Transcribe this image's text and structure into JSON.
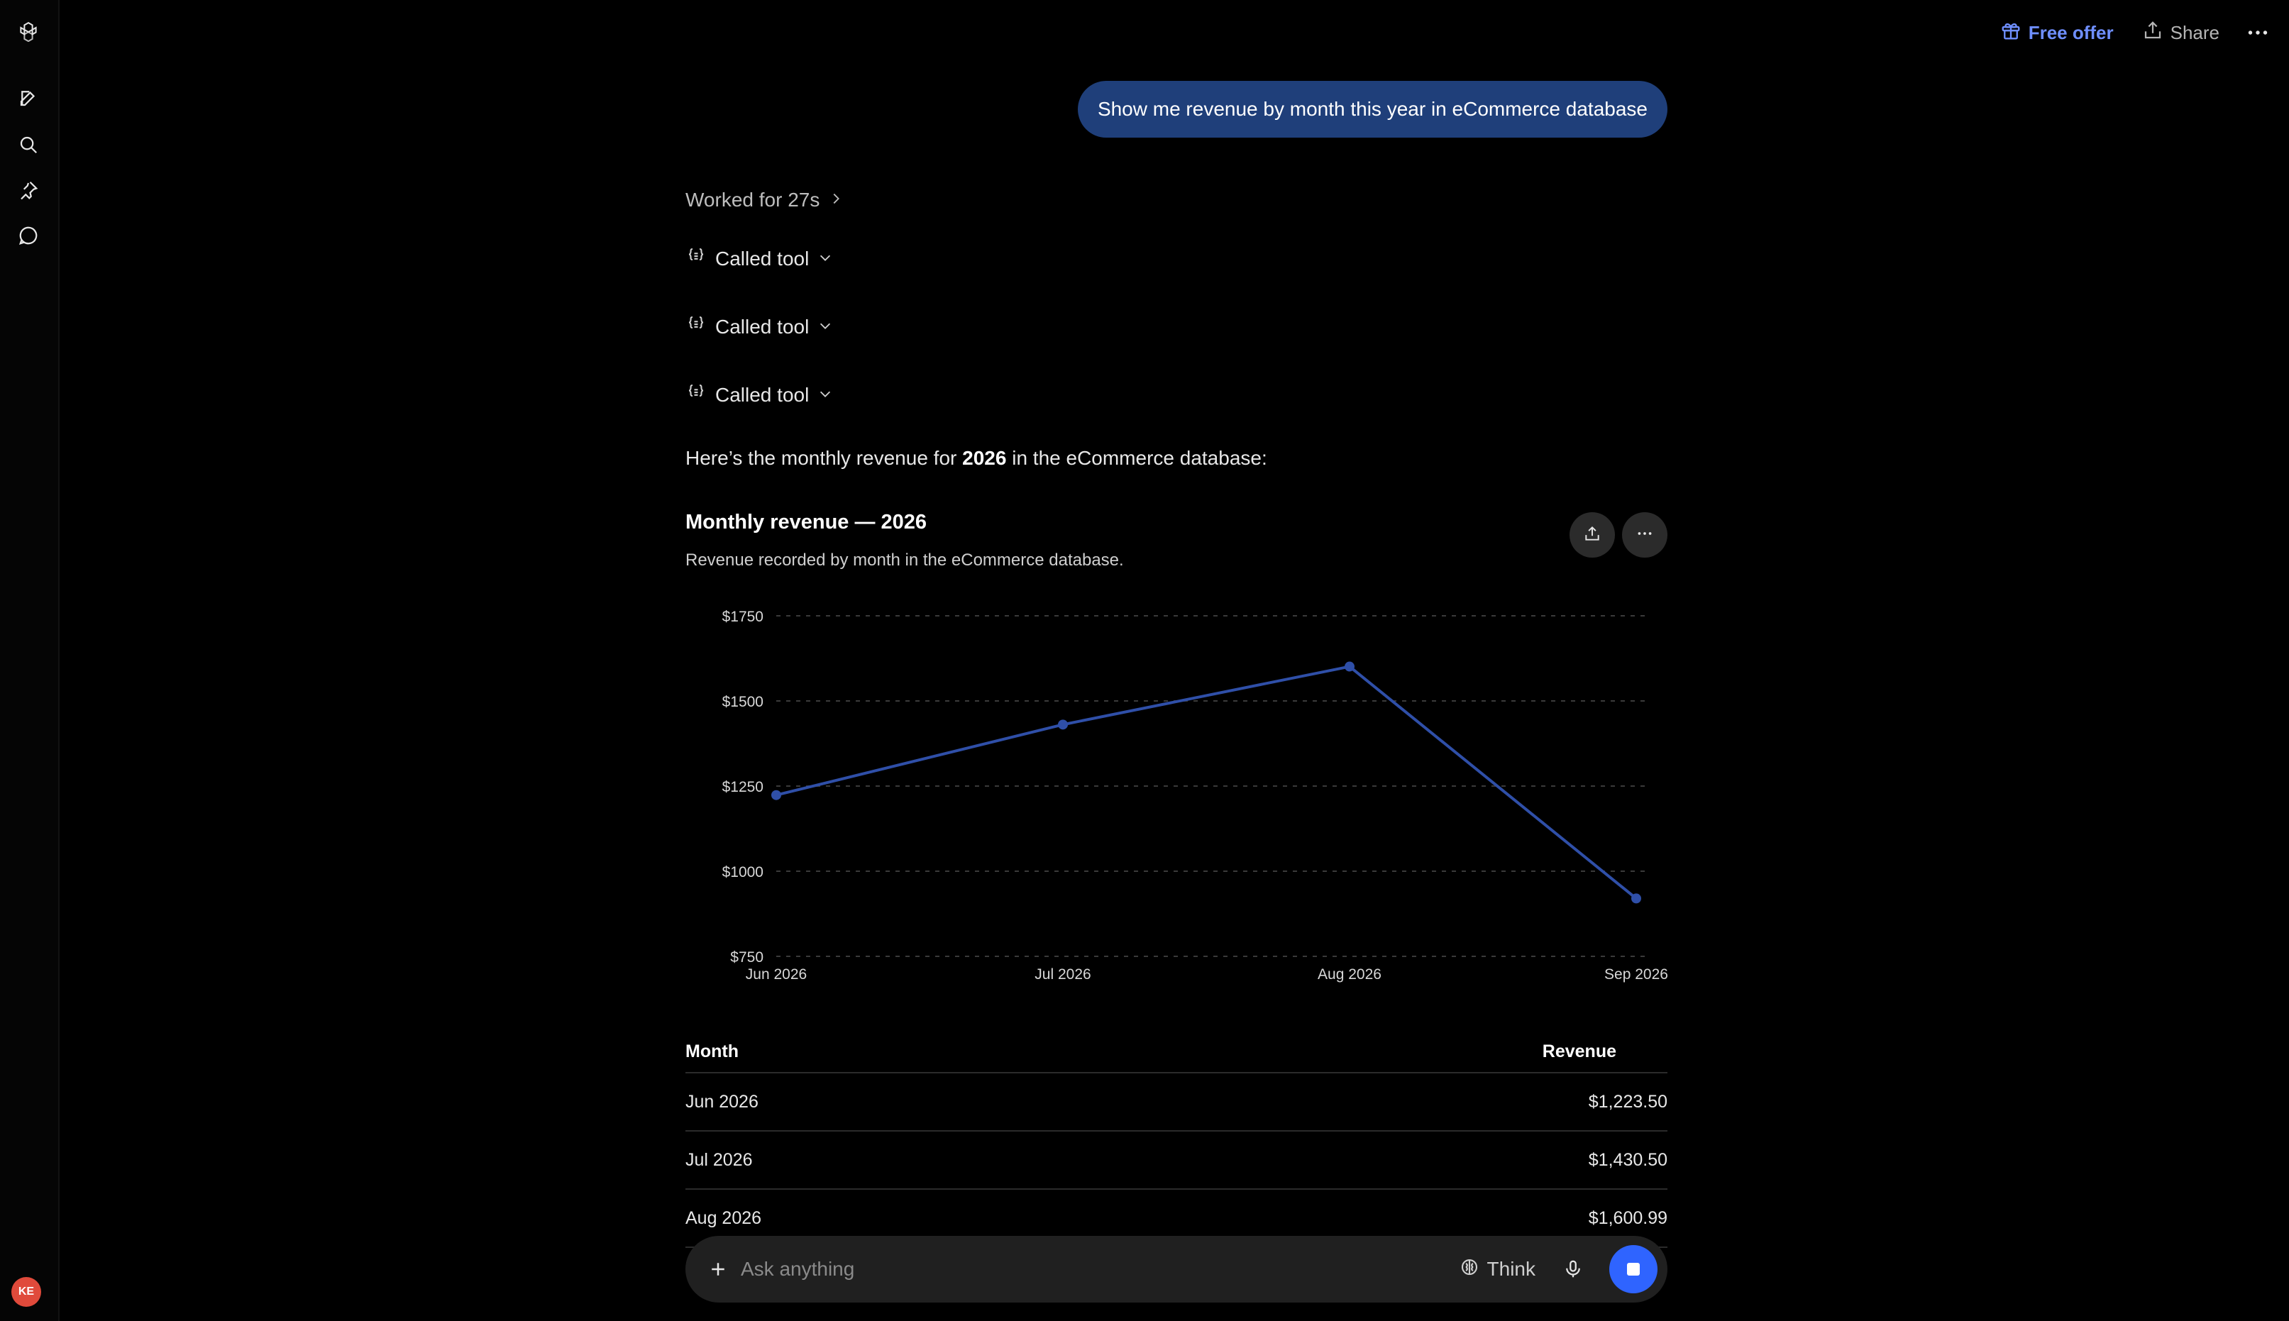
{
  "topbar": {
    "free_offer": "Free offer",
    "share": "Share"
  },
  "conversation": {
    "user_message": "Show me revenue by month this year in eCommerce database",
    "worked_for": "Worked for 27s",
    "tool_calls": [
      {
        "label": "Called tool"
      },
      {
        "label": "Called tool"
      },
      {
        "label": "Called tool"
      }
    ],
    "intro_prefix": "Here’s the monthly revenue for ",
    "intro_year": "2026",
    "intro_suffix": " in the eCommerce database:"
  },
  "chart_card": {
    "title": "Monthly revenue — 2026",
    "subtitle": "Revenue recorded by month in the eCommerce database."
  },
  "chart_data": {
    "type": "line",
    "categories": [
      "Jun 2026",
      "Jul 2026",
      "Aug 2026",
      "Sep 2026"
    ],
    "series": [
      {
        "values": [
          1223.5,
          1430.5,
          1600.99,
          920
        ]
      }
    ],
    "ylim": [
      750,
      1750
    ],
    "yticks": [
      750,
      1000,
      1250,
      1500,
      1750
    ],
    "ytick_labels": [
      "$750",
      "$1000",
      "$1250",
      "$1500",
      "$1750"
    ],
    "grid": true,
    "line_color": "#2f4fa8"
  },
  "table": {
    "headers": {
      "month": "Month",
      "revenue": "Revenue"
    },
    "rows": [
      {
        "month": "Jun 2026",
        "revenue": "$1,223.50"
      },
      {
        "month": "Jul 2026",
        "revenue": "$1,430.50"
      },
      {
        "month": "Aug 2026",
        "revenue": "$1,600.99"
      }
    ]
  },
  "composer": {
    "placeholder": "Ask anything",
    "think_label": "Think"
  },
  "user": {
    "avatar_initials": "KE",
    "avatar_color": "#e04a3b"
  },
  "colors": {
    "accent_bubble": "#1f3f7a",
    "link_blue": "#6f8fff",
    "send_button": "#2f64ff"
  }
}
